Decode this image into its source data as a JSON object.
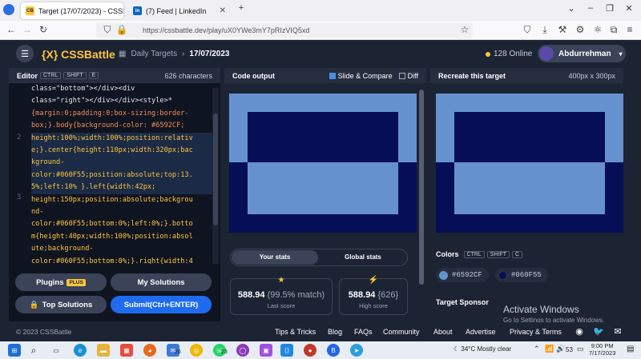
{
  "browser": {
    "tabs": [
      {
        "label": "Target (17/07/2023) - CSSBattle",
        "favicon": "CB",
        "active": true
      },
      {
        "label": "(7) Feed | LinkedIn",
        "favicon": "in",
        "active": false
      }
    ],
    "url": "https://cssbattle.dev/play/uX0YWe3mY7pRIzVIQ5xd"
  },
  "header": {
    "logo": "{X} CSSBattle",
    "breadcrumb_parent": "Daily Targets",
    "breadcrumb_current": "17/07/2023",
    "online": "128 Online",
    "username": "Abdurrehman"
  },
  "editor": {
    "title": "Editor",
    "keys": [
      "CTRL",
      "SHIFT",
      "E"
    ],
    "char_count": "626 characters",
    "line_numbers": [
      "2",
      "3"
    ],
    "code_lines": [
      "class=\"bottom\"></div><div",
      "class=\"right\"></div></div><style>*",
      "{margin:0;padding:0;box-sizing:border-",
      "box;}.body{background-color: #6592CF;",
      "height:100%;width:100%;position:relativ",
      "e;}.center{height:110px;width:320px;bac",
      "kground-",
      "color:#060F55;position:absolute;top:13.",
      "5%;left:10% }.left{width:42px;",
      "height:150px;position:absolute;backgrou",
      "nd-",
      "color:#060F55;bottom:0%;left:0%;}.botto",
      "m{height:40px;width:100%;position:absol",
      "ute;background-",
      "color:#060F55;bottom:0%;}.right{width:4"
    ],
    "buttons": {
      "plugins": "Plugins",
      "plugins_badge": "PLUS",
      "my_solutions": "My Solutions",
      "top_solutions": "Top Solutions",
      "submit": "Submit(Ctrl+ENTER)"
    }
  },
  "output": {
    "title": "Code output",
    "slide_compare": "Slide & Compare",
    "diff": "Diff",
    "tabs": [
      "Your stats",
      "Global stats"
    ],
    "last_score_value": "588.94",
    "last_score_match": "(99.5% match)",
    "last_score_label": "Last score",
    "high_score_value": "588.94",
    "high_score_chars": "{626}",
    "high_score_label": "High score"
  },
  "target": {
    "title": "Recreate this target",
    "size": "400px x 300px",
    "colors_label": "Colors",
    "color_keys": [
      "CTRL",
      "SHIFT",
      "C"
    ],
    "colors": [
      "#6592CF",
      "#060F55"
    ],
    "sponsor_label": "Target Sponsor"
  },
  "watermark": {
    "line1": "Activate Windows",
    "line2": "Go to Settings to activate Windows."
  },
  "footer": {
    "copyright": "© 2023 CSSBattle",
    "links": [
      "Tips & Tricks",
      "Blog",
      "FAQs",
      "Community",
      "About",
      "Advertise",
      "Privacy & Terms"
    ]
  },
  "taskbar": {
    "badge_mail": "26",
    "badge_whatsapp": "23",
    "temperature": "34°C",
    "weather": "Mostly clear",
    "volume": "53",
    "time": "9:00 PM",
    "date": "7/17/2023"
  }
}
